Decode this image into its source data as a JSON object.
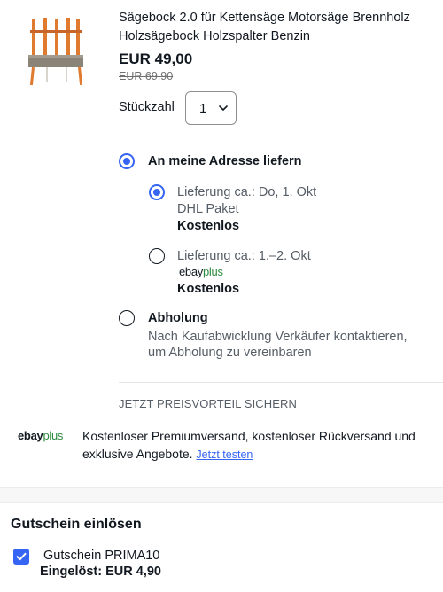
{
  "product": {
    "image_icon": "product-thumbnail",
    "title": "Sägebock 2.0 für Kettensäge Motorsäge Brennholz Holzsägebock Holzspalter Benzin",
    "price": "EUR 49,00",
    "old_price": "EUR 69,90"
  },
  "quantity": {
    "label": "Stückzahl",
    "value": "1"
  },
  "delivery": {
    "ship_to_address": {
      "label": "An meine Adresse liefern",
      "selected": true
    },
    "options": [
      {
        "line1": "Lieferung ca.: Do, 1. Okt",
        "line2": "DHL Paket",
        "cost": "Kostenlos",
        "selected": true
      },
      {
        "line1": "Lieferung ca.: 1.–2. Okt",
        "badge_ebay": "ebay",
        "badge_plus": "plus",
        "cost": "Kostenlos",
        "selected": false
      }
    ],
    "pickup": {
      "label": "Abholung",
      "line1": "Nach Kaufabwicklung Verkäufer kontaktieren,",
      "line2": "um Abholung zu vereinbaren",
      "selected": false
    }
  },
  "promo": {
    "heading": "JETZT PREISVORTEIL SICHERN",
    "logo_ebay": "ebay",
    "logo_plus": "plus",
    "text": "Kostenloser Premiumversand, kostenloser Rückversand und exklusive Angebote.",
    "link": "Jetzt testen"
  },
  "voucher": {
    "heading": "Gutschein einlösen",
    "code_label": "Gutschein PRIMA10",
    "redeemed": "Eingelöst: EUR 4,90",
    "checked": true
  },
  "colors": {
    "accent": "#3665f3",
    "text": "#111820",
    "secondary": "#555d66",
    "plus_green": "#2d8a3e"
  }
}
